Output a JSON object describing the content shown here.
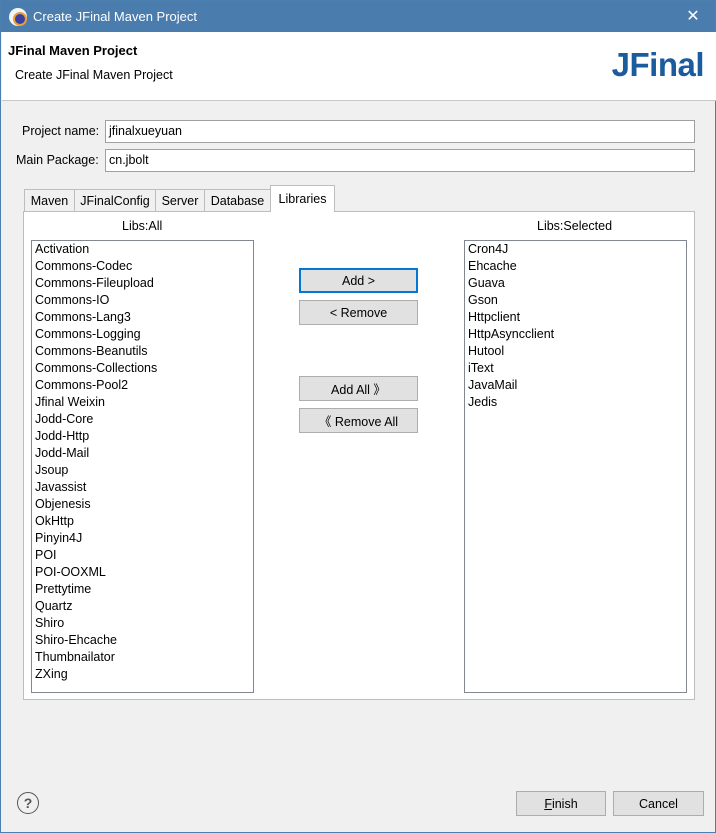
{
  "window": {
    "title": "Create JFinal Maven Project",
    "close_glyph": "✕"
  },
  "header": {
    "title": "JFinal Maven Project",
    "subtitle": "Create JFinal Maven Project",
    "logo": "JFinal"
  },
  "form": {
    "project_name_label": "Project name:",
    "project_name_value": "jfinalxueyuan",
    "main_package_label": "Main Package:",
    "main_package_value": "cn.jbolt"
  },
  "tabs": [
    {
      "label": "Maven",
      "active": false
    },
    {
      "label": "JFinalConfig",
      "active": false
    },
    {
      "label": "Server",
      "active": false
    },
    {
      "label": "Database",
      "active": false
    },
    {
      "label": "Libraries",
      "active": true
    }
  ],
  "libraries": {
    "all_label": "Libs:All",
    "selected_label": "Libs:Selected",
    "all": [
      "Activation",
      "Commons-Codec",
      "Commons-Fileupload",
      "Commons-IO",
      "Commons-Lang3",
      "Commons-Logging",
      "Commons-Beanutils",
      "Commons-Collections",
      "Commons-Pool2",
      "Jfinal Weixin",
      "Jodd-Core",
      "Jodd-Http",
      "Jodd-Mail",
      "Jsoup",
      "Javassist",
      "Objenesis",
      "OkHttp",
      "Pinyin4J",
      "POI",
      "POI-OOXML",
      "Prettytime",
      "Quartz",
      "Shiro",
      "Shiro-Ehcache",
      "Thumbnailator",
      "ZXing"
    ],
    "selected": [
      "Cron4J",
      "Ehcache",
      "Guava",
      "Gson",
      "Httpclient",
      "HttpAsyncclient",
      "Hutool",
      "iText",
      "JavaMail",
      "Jedis"
    ],
    "add_label": "Add >",
    "remove_label": "< Remove",
    "add_all_label": "Add All 》",
    "remove_all_label": "《 Remove All"
  },
  "footer": {
    "help_glyph": "?",
    "finish_mnemonic": "F",
    "finish_rest": "inish",
    "cancel_label": "Cancel"
  }
}
